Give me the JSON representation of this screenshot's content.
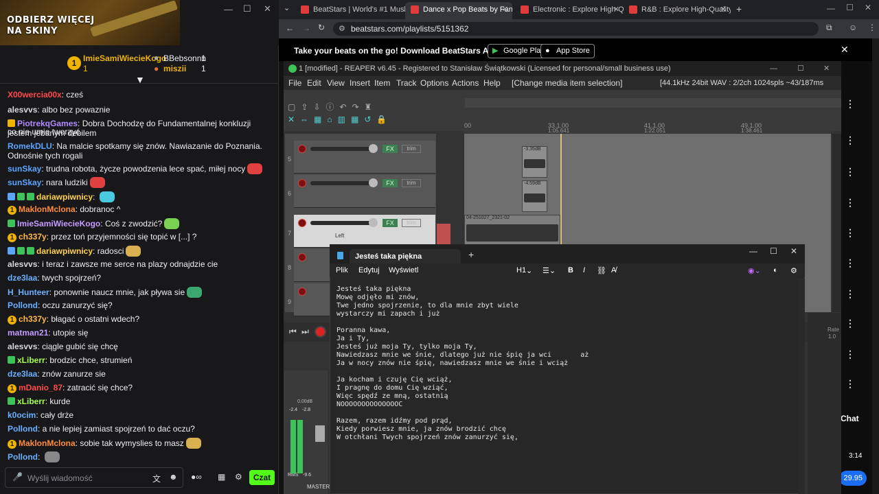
{
  "chat": {
    "banner_line1": "ODBIERZ WIĘCEJ",
    "banner_line2": "NA SKINY",
    "topic": "Czat",
    "leaders": [
      {
        "rank": "1",
        "name": "ImieSamiWiecieKogo",
        "count": "1"
      },
      {
        "name": "BBebsonnn",
        "count": "1"
      },
      {
        "name": "miszii",
        "count": "1"
      }
    ],
    "messages": [
      {
        "user": "X00wercia00x",
        "color": "#ff4a4a",
        "text": "cześ"
      },
      {
        "user": "alesvvs",
        "color": "#d9d9d9",
        "text": "albo bez powaznie"
      },
      {
        "user": "PiotrekqGames",
        "color": "#b18cff",
        "text": "Dobra Dochodzę do Fundamentalnej konkluzji jestem jebanym debilem"
      },
      {
        "user": "",
        "color": "#fff",
        "text": "co nie umie tworzyć"
      },
      {
        "user": "RomekDLU",
        "color": "#5aa5ff",
        "text": "Na malcie spotkamy się znów. Nawiazanie do Poznania. Odnośnie tych rogali"
      },
      {
        "user": "sunSkay",
        "color": "#5aa5ff",
        "text": "trudna robota, życze powodzenia lece spać, miłej nocy"
      },
      {
        "user": "sunSkay",
        "color": "#5aa5ff",
        "text": "nara ludziki"
      },
      {
        "user": "dariawpiwnicy",
        "color": "#ffd24a",
        "text": ""
      },
      {
        "user": "MaklonMclona",
        "color": "#ff8c3a",
        "text": "dobranoc ^"
      },
      {
        "user": "ImieSamiWiecieKogo",
        "color": "#c49cff",
        "text": "Coś z zwodzić?"
      },
      {
        "user": "ch337y",
        "color": "#ffb84a",
        "text": "przez toń przyjemności się topić w [...] ?"
      },
      {
        "user": "dariawpiwnicy",
        "color": "#ffd24a",
        "text": "radosci"
      },
      {
        "user": "alesvvs",
        "color": "#d9d9d9",
        "text": "i teraz i zawsze me serce na plazy odnajdzie cie"
      },
      {
        "user": "dze3laa",
        "color": "#6ab0ff",
        "text": "twych spojrzeń?"
      },
      {
        "user": "H_Hunteer",
        "color": "#6ab0ff",
        "text": "ponownie naucz mnie, jak pływa sie"
      },
      {
        "user": "Pollond",
        "color": "#6ab0ff",
        "text": "oczu zanurzyć się?"
      },
      {
        "user": "ch337y",
        "color": "#ffb84a",
        "text": "błagać o ostatni wdech?"
      },
      {
        "user": "matman21",
        "color": "#c49cff",
        "text": "utopie się"
      },
      {
        "user": "alesvvs",
        "color": "#d9d9d9",
        "text": "ciągle gubić się chcę"
      },
      {
        "user": "xLiberr",
        "color": "#a6ff4a",
        "text": "brodzic chce, strumień"
      },
      {
        "user": "dze3laa",
        "color": "#6ab0ff",
        "text": "znów zanurze sie"
      },
      {
        "user": "mDanio_87",
        "color": "#ff4a4a",
        "text": "zatracić się chce?"
      },
      {
        "user": "xLiberr",
        "color": "#a6ff4a",
        "text": "kurde"
      },
      {
        "user": "k0ocim",
        "color": "#6ab0ff",
        "text": "cały drże"
      },
      {
        "user": "Pollond",
        "color": "#6ab0ff",
        "text": "a nie lepiej zamiast spojrzeń to dać oczu?"
      },
      {
        "user": "MaklonMclona",
        "color": "#ff8c3a",
        "text": "sobie tak wymyslies to masz"
      },
      {
        "user": "Pollond",
        "color": "#6ab0ff",
        "text": ""
      }
    ],
    "input_placeholder": "Wyślij wiadomość",
    "send_label": "Czat"
  },
  "browser": {
    "tabs": [
      {
        "label": "BeatStars | World's #1 Music M",
        "color": "#e03c3c"
      },
      {
        "label": "Dance x Pop Beats by Fantom",
        "color": "#e03c3c"
      },
      {
        "label": "Electronic : Explore High-Quali",
        "color": "#e03c3c"
      },
      {
        "label": "R&B : Explore High-Quality R&B",
        "color": "#e03c3c"
      }
    ],
    "url": "beatstars.com/playlists/5151362",
    "promo": "Take your beats on the go! Download BeatStars App",
    "google_play": "Google Play",
    "app_store": "App Store",
    "chat_label": "Chat",
    "time": "3:14",
    "price": "29.95"
  },
  "reaper": {
    "title": "1 [modified] - REAPER v6.45 - Registered to Stanisław Świątkowski (Licensed for personal/small business use)",
    "menu": [
      "File",
      "Edit",
      "View",
      "Insert",
      "Item",
      "Track",
      "Options",
      "Actions",
      "Help"
    ],
    "status_left": "[Change media item selection]",
    "status_right": "[44.1kHz 24bit WAV : 2/2ch 1024spls ~43/187ms WaveOut]",
    "ruler": [
      "00",
      "33.1.00",
      "41.1.00",
      "49.1.00"
    ],
    "ruler_sub": [
      "",
      "1:05.641",
      "1:22.051",
      "1:38.461"
    ],
    "tracks": [
      "5",
      "6",
      "7",
      "8",
      "9"
    ],
    "clip_labels": [
      "-3.35dB",
      "-4.59dB",
      "04-251027_2321-02"
    ],
    "left_label": "Left",
    "master": "MASTER",
    "rate": "Rate",
    "rate_val": "1.0",
    "meter_vals": [
      "-2.4",
      "-2.8"
    ],
    "rms": "RMS",
    "rms_val": "-9.6",
    "db_label": "0.00dB"
  },
  "notepad": {
    "tab_title": "Jesteś taka piękna",
    "menu": [
      "Plik",
      "Edytuj",
      "Wyświetl"
    ],
    "heading": "H1",
    "text": "Jesteś taka piękna\nMowę odjęło mi znów,\nTwe jedno spojrzenie, to dla mnie zbyt wiele\nwystarczy mi zapach i już\n\nPoranna kawa,\nJa i Ty,\nJesteś już moja Ty, tylko moja Ty,\nNawiedzasz mnie we śnie, dlatego już nie śpię ja wci       aż\nJa w nocy znów nie śpię, nawiedzasz mnie we śnie i wciąż\n\nJa kocham i czuję Cię wciąż,\nI pragnę do domu Cię wziąć,\nWięc spędź ze mną, ostatnią\nNOOOOOOOOOOOOOOC\n\nRazem, razem idźmy pod prąd,\nKiedy porwiesz mnie, ja znów brodzić chcę\nW otchłani Twych spojrzeń znów zanurzyć się,"
  }
}
